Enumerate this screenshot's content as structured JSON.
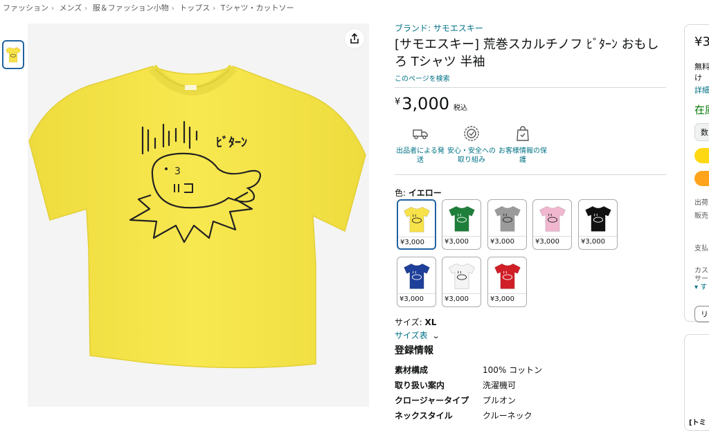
{
  "breadcrumb": [
    "ファッション",
    "メンズ",
    "服＆ファッション小物",
    "トップス",
    "Tシャツ・カットソー"
  ],
  "product": {
    "brand": "ブランド: サモエスキー",
    "title": "[サモエスキー] 荒巻スカルチノフ ﾋﾞﾀｰﾝ おもしろ Tシャツ 半袖",
    "search_page": "このページを検索",
    "price_symbol": "¥",
    "price": "3,000",
    "tax": "税込",
    "shirt_text": "ﾋﾞﾀｰﾝ"
  },
  "features": [
    {
      "icon": "truck-icon",
      "label": "出品者による発送"
    },
    {
      "icon": "shield-icon",
      "label": "安心・安全への取り組み"
    },
    {
      "icon": "bag-lock-icon",
      "label": "お客様情報の保護"
    }
  ],
  "color": {
    "label": "色: ",
    "selected": "イエロー",
    "options": [
      {
        "price": "¥3,000",
        "color": "#f7e24a"
      },
      {
        "price": "¥3,000",
        "color": "#1e7f3a"
      },
      {
        "price": "¥3,000",
        "color": "#9b9b9b"
      },
      {
        "price": "¥3,000",
        "color": "#f1b7cf"
      },
      {
        "price": "¥3,000",
        "color": "#111111"
      },
      {
        "price": "¥3,000",
        "color": "#1e3f9a"
      },
      {
        "price": "¥3,000",
        "color": "#f4f4f4"
      },
      {
        "price": "¥3,000",
        "color": "#d01f26"
      }
    ]
  },
  "size": {
    "label": "サイズ: ",
    "value": "XL",
    "table_link": "サイズ表"
  },
  "registration": {
    "heading": "登録情報",
    "rows": [
      {
        "key": "素材構成",
        "value": "100% コットン"
      },
      {
        "key": "取り扱い案内",
        "value": "洗濯機可"
      },
      {
        "key": "クロージャータイプ",
        "value": "プルオン"
      },
      {
        "key": "ネックスタイル",
        "value": "クルーネック"
      }
    ]
  },
  "buybox": {
    "price": "¥3",
    "line1": "無料",
    "line2": "け",
    "details": "詳細",
    "stock": "在庫",
    "qty": "数",
    "ship_from": "出荷",
    "seller": "販売",
    "payment": "支払",
    "custom1": "カス",
    "custom2": "サー",
    "expand": "▾ す",
    "list": "リ",
    "bottom": "[トミ"
  },
  "colors": {
    "link": "#007185",
    "selected_border": "#2162a1",
    "cart_yellow": "#ffd814",
    "buy_orange": "#ffa41c",
    "stock_green": "#007600"
  }
}
